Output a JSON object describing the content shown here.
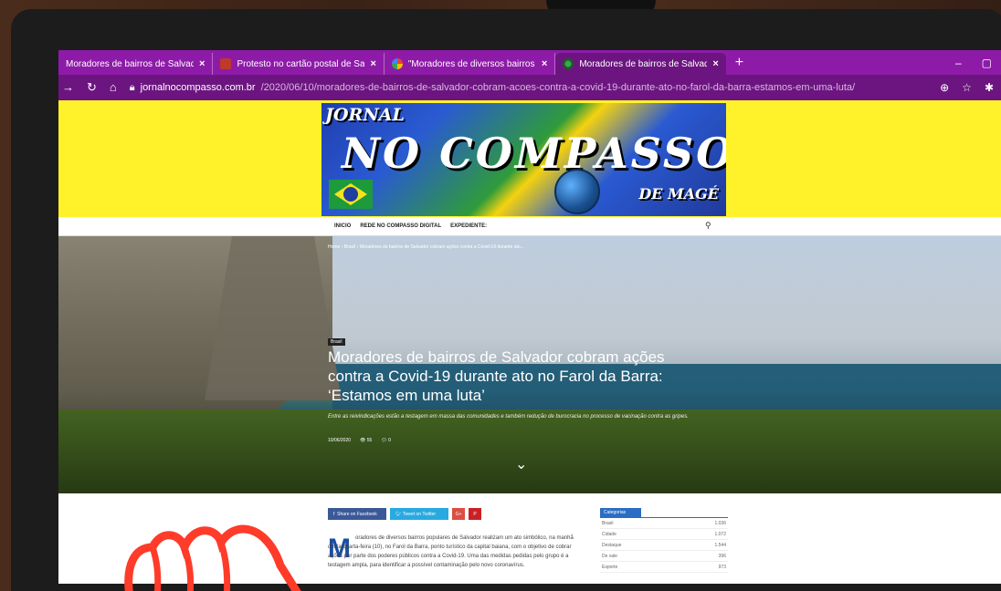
{
  "browser": {
    "tabs": [
      {
        "title": "Moradores de bairros de Salvado",
        "icon": "none"
      },
      {
        "title": "Protesto no cartão postal de Sal",
        "icon": "tab-favicon-icon"
      },
      {
        "title": "\"Moradores de diversos bairros p",
        "icon": "google-icon"
      },
      {
        "title": "Moradores de bairros de Salvado",
        "icon": "site-favicon-icon",
        "active": true
      }
    ],
    "close_glyph": "×",
    "new_tab": "+",
    "minimize": "–",
    "restore": "▢",
    "url_host": "jornalnocompasso.com.br",
    "url_path": "/2020/06/10/moradores-de-bairros-de-salvador-cobram-acoes-contra-a-covid-19-durante-ato-no-farol-da-barra-estamos-em-uma-luta/",
    "colors": {
      "tabbar": "#8e1ba8",
      "toolbar": "#6c1580"
    }
  },
  "site": {
    "logo": {
      "jornal": "JORNAL",
      "main": "NO COMPASSO",
      "sub": "DE MAGÉ"
    },
    "menu": [
      "INICIO",
      "REDE NO COMPASSO DIGITAL",
      "EXPEDIENTE:"
    ],
    "colors": {
      "banner": "#fff22a"
    }
  },
  "article": {
    "breadcrumb": "Home › Brasil › Moradores de bairros de Salvador cobram ações contra a Covid-19 durante ato...",
    "category": "Brasil",
    "title": "Moradores de bairros de Salvador cobram ações contra a Covid-19 durante ato no Farol da Barra: ‘Estamos em uma luta’",
    "dek": "Entre as reivindicações estão a testagem em massa das comunidades e também redução de burocracia no processo de vacinação contra as gripes.",
    "date": "10/06/2020",
    "views": "55",
    "comments": "0",
    "share": {
      "facebook": "Share on Facebook",
      "twitter": "Tweet on Twitter",
      "gplus": "G+",
      "pinterest": "P"
    },
    "dropcap": "M",
    "body": "oradores de diversos bairros populares de Salvador realizam um ato simbólico, na manhã desta quarta-feira (10), no Farol da Barra, ponto turístico da capital baiana, com o objetivo de cobrar ações por parte dos poderes públicos contra a Covid-19. Uma das medidas pedidas pelo grupo é a testagem ampla, para identificar a possível contaminação pelo novo coronavírus."
  },
  "sidebar": {
    "heading": "Categorias",
    "categories": [
      {
        "name": "Brasil",
        "count": "1.036"
      },
      {
        "name": "Cidade",
        "count": "1.072"
      },
      {
        "name": "Destaque",
        "count": "1.544"
      },
      {
        "name": "De vale",
        "count": "396"
      },
      {
        "name": "Esporte",
        "count": "973"
      }
    ]
  }
}
